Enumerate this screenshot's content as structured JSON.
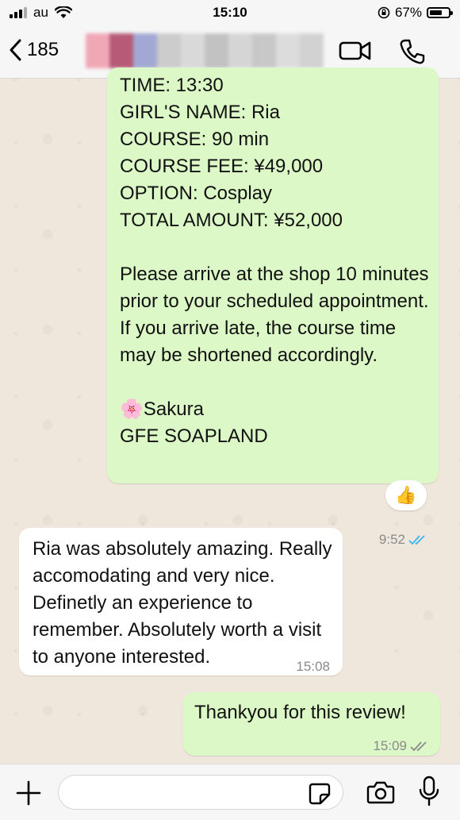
{
  "status_bar": {
    "carrier": "au",
    "time": "15:10",
    "battery": "67%",
    "battery_level": 0.67
  },
  "header": {
    "back_count": "185",
    "contact_name": ""
  },
  "messages": [
    {
      "direction": "outgoing",
      "text": "TIME: 13:30\nGIRL'S NAME: Ria\nCOURSE: 90 min\nCOURSE FEE: ¥49,000\nOPTION: Cosplay\nTOTAL AMOUNT: ¥52,000\n\nPlease arrive at the shop 10 minutes prior to your scheduled appointment.\nIf you arrive late, the course time may be shortened accordingly.\n\n🌸Sakura\nGFE SOAPLAND",
      "time": "9:52",
      "status": "read",
      "reaction": "👍"
    },
    {
      "direction": "incoming",
      "text": "Ria was absolutely amazing. Really accomodating and very nice. Definetly an experience to remember. Absolutely worth a visit to anyone interested.",
      "time": "15:08"
    },
    {
      "direction": "outgoing",
      "text": "Thankyou for this review!",
      "time": "15:09",
      "status": "delivered"
    }
  ],
  "input": {
    "placeholder": "",
    "value": ""
  },
  "colors": {
    "outgoing_bubble": "#dcf8c6",
    "incoming_bubble": "#ffffff",
    "read_ticks": "#34b7f1",
    "delivered_ticks": "#8a8a8a",
    "wallpaper": "#efe7dc"
  },
  "icons": {
    "back": "chevron-left-icon",
    "video": "video-camera-icon",
    "call": "phone-icon",
    "attach": "plus-icon",
    "sticker": "sticker-icon",
    "camera": "camera-icon",
    "mic": "microphone-icon"
  }
}
